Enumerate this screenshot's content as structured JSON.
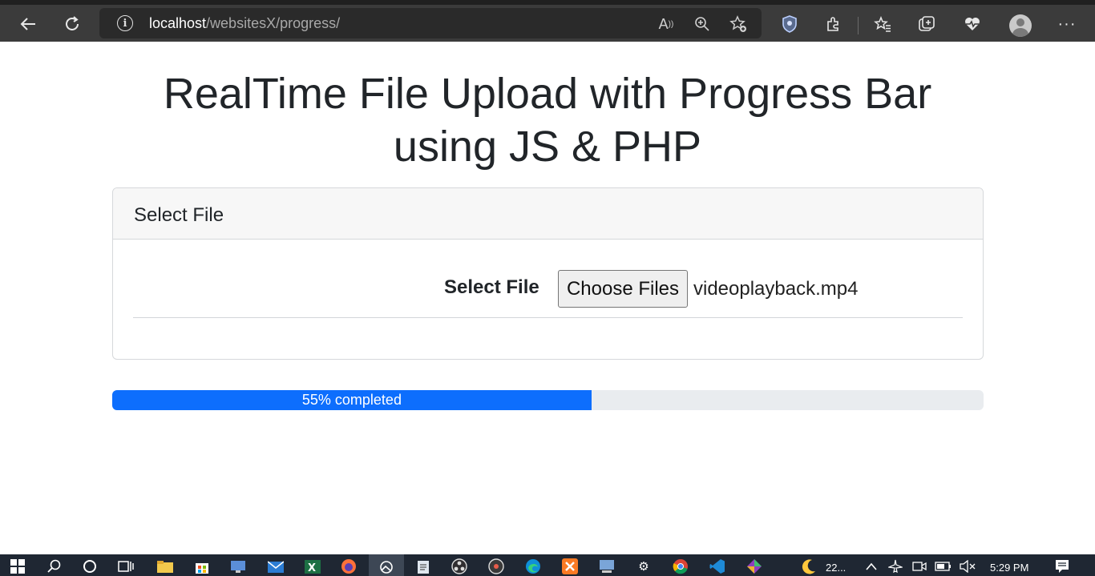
{
  "browser": {
    "url_host": "localhost",
    "url_path": "/websitesX/progress/",
    "icons": {
      "back": "back-arrow-icon",
      "refresh": "refresh-icon",
      "info": "info-icon",
      "read_aloud": "read-aloud-icon",
      "zoom": "zoom-icon",
      "add_favorite": "add-favorite-icon",
      "shield": "shield-icon",
      "extensions": "extensions-icon",
      "favorites": "favorites-icon",
      "collections": "collections-icon",
      "health": "browser-essentials-icon",
      "profile": "profile-icon",
      "more": "more-icon"
    }
  },
  "page": {
    "title_line1": "RealTime File Upload with Progress Bar",
    "title_line2": "using JS & PHP"
  },
  "card": {
    "header": "Select File",
    "label": "Select File",
    "choose_button": "Choose Files",
    "file_name": "videoplayback.mp4"
  },
  "progress": {
    "percent": 55,
    "label": "55% completed",
    "bar_color": "#0d6efd",
    "track_color": "#e9ecef"
  },
  "taskbar": {
    "weather_text": "22...",
    "time": "5:29 PM"
  }
}
